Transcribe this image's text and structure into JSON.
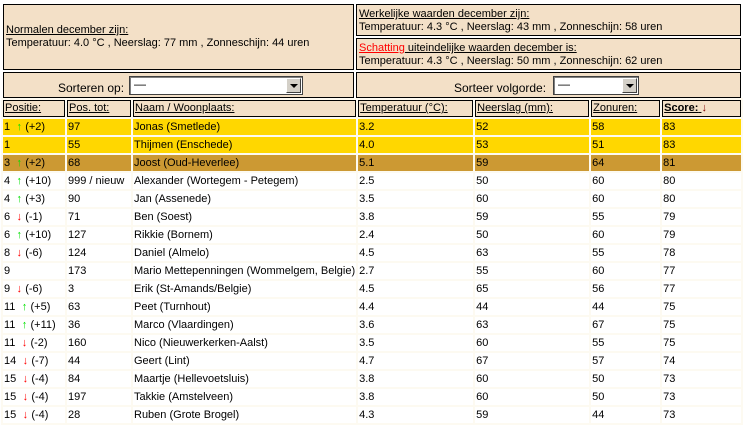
{
  "normals": {
    "title": "Normalen december zijn:",
    "text": "Temperatuur: 4.0 °C , Neerslag: 77 mm , Zonneschijn: 44 uren"
  },
  "actual": {
    "title": "Werkelijke waarden december zijn:",
    "text": "Temperatuur: 4.3 °C , Neerslag: 43 mm , Zonneschijn: 58 uren"
  },
  "estimate": {
    "title_red": "Schatting",
    "title_rest": " uiteindelijke waarden december is:",
    "text": "Temperatuur: 4.3 °C , Neerslag: 50 mm , Zonneschijn: 62 uren"
  },
  "sort": {
    "label": "Sorteren op:",
    "value": "—",
    "order_label": "Sorteer volgorde:",
    "order_value": "—"
  },
  "columns": [
    "Positie:",
    "Pos. tot:",
    "Naam / Woonplaats:",
    "Temperatuur (°C):",
    "Neerslag (mm):",
    "Zonuren:",
    "Score:"
  ],
  "score_sort_icon": "↓",
  "colors": {
    "header_bg": "#f3e0c7",
    "gold": "#ffd700",
    "bronze": "#cc9933",
    "up": "#00e000",
    "down": "#ff0000"
  },
  "rows": [
    {
      "pos": "1",
      "dir": "up",
      "change": "(+2)",
      "tot": "97",
      "name": "Jonas (Smetlede)",
      "temp": "3.2",
      "rain": "52",
      "sun": "58",
      "score": "83",
      "medal": "gold"
    },
    {
      "pos": "1",
      "dir": "",
      "change": "",
      "tot": "55",
      "name": "Thijmen (Enschede)",
      "temp": "4.0",
      "rain": "53",
      "sun": "51",
      "score": "83",
      "medal": "gold"
    },
    {
      "pos": "3",
      "dir": "up",
      "change": "(+2)",
      "tot": "68",
      "name": "Joost (Oud-Heverlee)",
      "temp": "5.1",
      "rain": "59",
      "sun": "64",
      "score": "81",
      "medal": "bronze"
    },
    {
      "pos": "4",
      "dir": "up",
      "change": "(+10)",
      "tot": "999 / nieuw",
      "name": "Alexander (Wortegem - Petegem)",
      "temp": "2.5",
      "rain": "50",
      "sun": "60",
      "score": "80",
      "medal": ""
    },
    {
      "pos": "4",
      "dir": "up",
      "change": "(+3)",
      "tot": "90",
      "name": "Jan (Assenede)",
      "temp": "3.5",
      "rain": "60",
      "sun": "60",
      "score": "80",
      "medal": ""
    },
    {
      "pos": "6",
      "dir": "down",
      "change": "(-1)",
      "tot": "71",
      "name": "Ben (Soest)",
      "temp": "3.8",
      "rain": "59",
      "sun": "55",
      "score": "79",
      "medal": ""
    },
    {
      "pos": "6",
      "dir": "up",
      "change": "(+10)",
      "tot": "127",
      "name": "Rikkie (Bornem)",
      "temp": "2.4",
      "rain": "50",
      "sun": "60",
      "score": "79",
      "medal": ""
    },
    {
      "pos": "8",
      "dir": "down",
      "change": "(-6)",
      "tot": "124",
      "name": "Daniel (Almelo)",
      "temp": "4.5",
      "rain": "63",
      "sun": "55",
      "score": "78",
      "medal": ""
    },
    {
      "pos": "9",
      "dir": "",
      "change": "",
      "tot": "173",
      "name": "Mario Mettepenningen (Wommelgem, Belgie)",
      "temp": "2.7",
      "rain": "55",
      "sun": "60",
      "score": "77",
      "medal": ""
    },
    {
      "pos": "9",
      "dir": "down",
      "change": "(-6)",
      "tot": "3",
      "name": "Erik (St-Amands/Belgie)",
      "temp": "4.5",
      "rain": "65",
      "sun": "56",
      "score": "77",
      "medal": ""
    },
    {
      "pos": "11",
      "dir": "up",
      "change": "(+5)",
      "tot": "63",
      "name": "Peet (Turnhout)",
      "temp": "4.4",
      "rain": "44",
      "sun": "44",
      "score": "75",
      "medal": ""
    },
    {
      "pos": "11",
      "dir": "up",
      "change": "(+11)",
      "tot": "36",
      "name": "Marco (Vlaardingen)",
      "temp": "3.6",
      "rain": "63",
      "sun": "67",
      "score": "75",
      "medal": ""
    },
    {
      "pos": "11",
      "dir": "down",
      "change": "(-2)",
      "tot": "160",
      "name": "Nico (Nieuwerkerken-Aalst)",
      "temp": "3.5",
      "rain": "60",
      "sun": "55",
      "score": "75",
      "medal": ""
    },
    {
      "pos": "14",
      "dir": "down",
      "change": "(-7)",
      "tot": "44",
      "name": "Geert (Lint)",
      "temp": "4.7",
      "rain": "67",
      "sun": "57",
      "score": "74",
      "medal": ""
    },
    {
      "pos": "15",
      "dir": "down",
      "change": "(-4)",
      "tot": "84",
      "name": "Maartje (Hellevoetsluis)",
      "temp": "3.8",
      "rain": "60",
      "sun": "50",
      "score": "73",
      "medal": ""
    },
    {
      "pos": "15",
      "dir": "down",
      "change": "(-4)",
      "tot": "197",
      "name": "Takkie (Amstelveen)",
      "temp": "3.8",
      "rain": "60",
      "sun": "50",
      "score": "73",
      "medal": ""
    },
    {
      "pos": "15",
      "dir": "down",
      "change": "(-4)",
      "tot": "28",
      "name": "Ruben (Grote Brogel)",
      "temp": "4.3",
      "rain": "59",
      "sun": "44",
      "score": "73",
      "medal": ""
    }
  ]
}
